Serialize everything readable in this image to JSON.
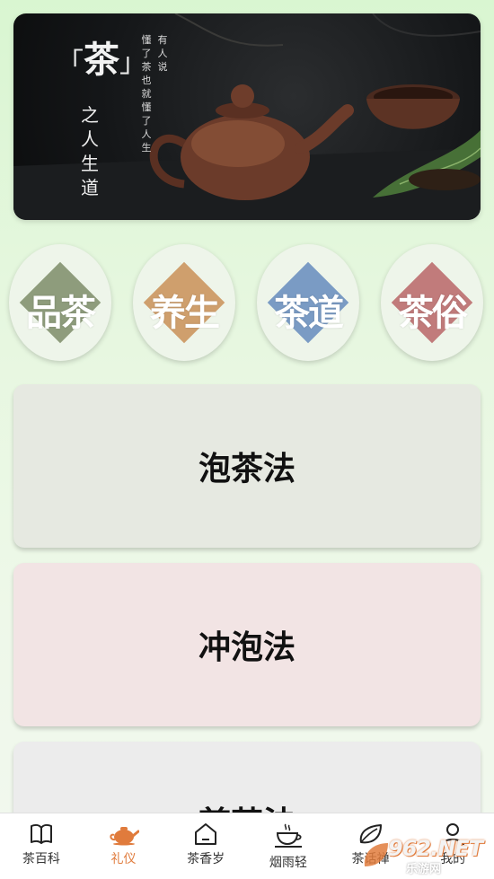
{
  "banner": {
    "title": "茶",
    "bracket_left": "「",
    "bracket_right": "」",
    "vertical_text": "之人生道",
    "poem_col1": "有人说",
    "poem_col2": "懂了茶也就懂了人生"
  },
  "categories": [
    {
      "label": "品茶",
      "color": "#8e9c7c"
    },
    {
      "label": "养生",
      "color": "#cf9f6d"
    },
    {
      "label": "茶道",
      "color": "#7a9bc4"
    },
    {
      "label": "茶俗",
      "color": "#c17b7b"
    }
  ],
  "cards": [
    {
      "label": "泡茶法"
    },
    {
      "label": "冲泡法"
    },
    {
      "label": "煎茶法"
    }
  ],
  "bottom_nav": {
    "items": [
      {
        "label": "茶百科",
        "icon": "book-icon"
      },
      {
        "label": "礼仪",
        "icon": "teapot-icon",
        "active": true
      },
      {
        "label": "茶香岁",
        "icon": "house-icon"
      },
      {
        "label": "烟雨轻",
        "icon": "teacup-icon"
      },
      {
        "label": "茶话禅",
        "icon": "leaf-icon"
      },
      {
        "label": "我的",
        "icon": "user-icon"
      }
    ],
    "active_color": "#e07b3c"
  },
  "watermark": {
    "main": "962.NET",
    "sub": "乐游网"
  }
}
